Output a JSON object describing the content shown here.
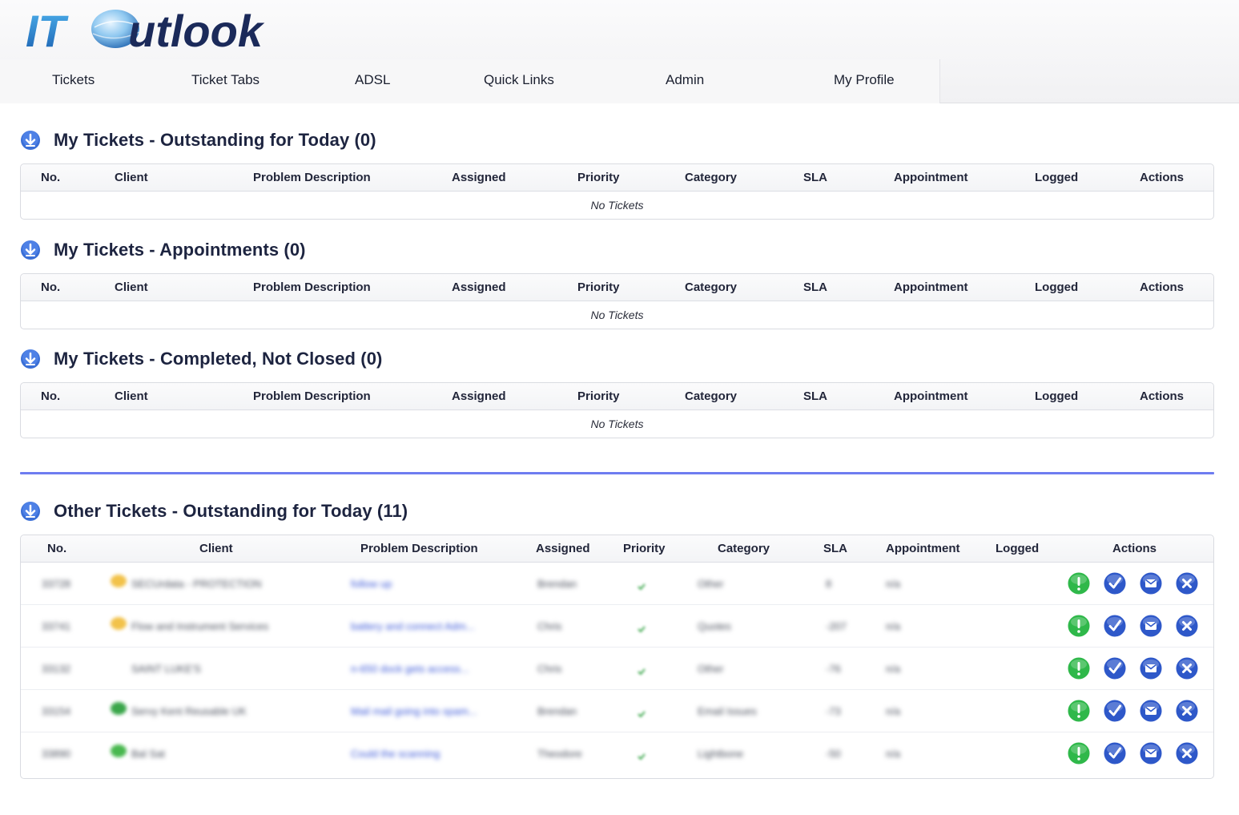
{
  "app": {
    "logo_text_a": "IT",
    "logo_text_b": "utlook"
  },
  "nav": [
    {
      "label": "Tickets"
    },
    {
      "label": "Ticket Tabs"
    },
    {
      "label": "ADSL"
    },
    {
      "label": "Quick Links"
    },
    {
      "label": "Admin"
    },
    {
      "label": "My Profile"
    }
  ],
  "columns": {
    "no": "No.",
    "client": "Client",
    "problem": "Problem Description",
    "assigned": "Assigned",
    "priority": "Priority",
    "category": "Category",
    "sla": "SLA",
    "appointment": "Appointment",
    "logged": "Logged",
    "actions": "Actions"
  },
  "sections": [
    {
      "title": "My Tickets - Outstanding for Today (0)",
      "empty_text": "No Tickets"
    },
    {
      "title": "My Tickets - Appointments (0)",
      "empty_text": "No Tickets"
    },
    {
      "title": "My Tickets - Completed, Not Closed (0)",
      "empty_text": "No Tickets"
    }
  ],
  "other_section": {
    "title": "Other Tickets - Outstanding for Today (11)",
    "rows": [
      {
        "no": "33728",
        "client": "SECUrdata - PROTECTION",
        "client_icon": "#f2c24a",
        "problem": "follow up",
        "assigned": "Brendan",
        "category": "Other",
        "sla": "8",
        "appointment": "n/a"
      },
      {
        "no": "33741",
        "client": "Flow and Instrument Services",
        "client_icon": "#f2c24a",
        "problem": "battery and connect Adm...",
        "assigned": "Chris",
        "category": "Quotes",
        "sla": "-207",
        "appointment": "n/a"
      },
      {
        "no": "33132",
        "client": "SAINT LUKE'S",
        "client_icon": "",
        "problem": "n-650 dock gets access...",
        "assigned": "Chris",
        "category": "Other",
        "sla": "-76",
        "appointment": "n/a"
      },
      {
        "no": "33154",
        "client": "Servy Kent Reusable UK",
        "client_icon": "#3aa64a",
        "problem": "Mail mail going into spam...",
        "assigned": "Brendan",
        "category": "Email Issues",
        "sla": "-73",
        "appointment": "n/a"
      },
      {
        "no": "33890",
        "client": "Bal Sat",
        "client_icon": "#49b84f",
        "problem": "Could the scanning",
        "assigned": "Theodore",
        "category": "Lightbone",
        "sla": "-50",
        "appointment": "n/a"
      }
    ]
  },
  "colors": {
    "accent": "#6e7cf0",
    "link": "#3b58d8",
    "action_green": "#2fb84a",
    "action_blue": "#2e58c9"
  }
}
